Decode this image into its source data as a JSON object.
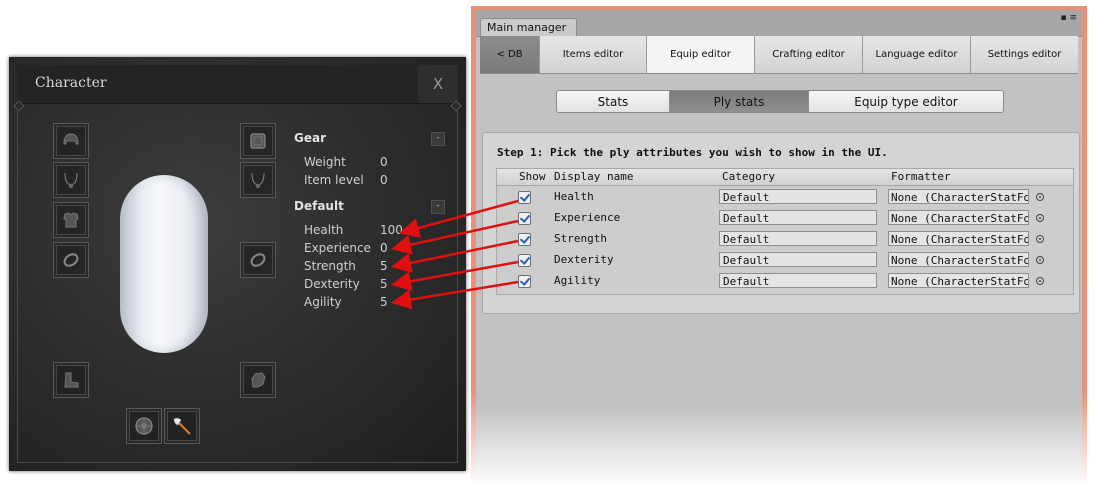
{
  "character": {
    "title": "Character",
    "close_label": "X",
    "equip_slots_left": [
      {
        "icon": "helmet-icon"
      },
      {
        "icon": "necklace-icon"
      },
      {
        "icon": "armor-icon"
      },
      {
        "icon": "ring-icon"
      }
    ],
    "equip_slots_right": [
      {
        "icon": "shield-frame-icon"
      },
      {
        "icon": "amulet-icon"
      },
      {
        "icon": "ring-icon"
      }
    ],
    "equip_slots_bottom": [
      {
        "icon": "boots-icon"
      },
      {
        "icon": "gauntlet-icon"
      },
      {
        "icon": "round-shield-icon"
      },
      {
        "icon": "axe-icon"
      }
    ],
    "gear": {
      "title": "Gear",
      "collapse_label": "-",
      "stats": [
        {
          "label": "Weight",
          "value": "0"
        },
        {
          "label": "Item level",
          "value": "0"
        }
      ]
    },
    "default": {
      "title": "Default",
      "collapse_label": "-",
      "stats": [
        {
          "label": "Health",
          "value": "100"
        },
        {
          "label": "Experience",
          "value": "0"
        },
        {
          "label": "Strength",
          "value": "5"
        },
        {
          "label": "Dexterity",
          "value": "5"
        },
        {
          "label": "Agility",
          "value": "5"
        }
      ]
    }
  },
  "manager": {
    "window_tab": "Main manager",
    "window_icons": "▪ ≡",
    "top_nav": [
      {
        "label": "< DB"
      },
      {
        "label": "Items editor"
      },
      {
        "label": "Equip editor"
      },
      {
        "label": "Crafting editor"
      },
      {
        "label": "Language editor"
      },
      {
        "label": "Settings editor"
      }
    ],
    "sub_nav": [
      {
        "label": "Stats"
      },
      {
        "label": "Ply stats"
      },
      {
        "label": "Equip type editor"
      }
    ],
    "step_label": "Step 1: Pick the ply attributes you wish to show in the UI.",
    "columns": {
      "show": "Show",
      "display_name": "Display name",
      "category": "Category",
      "formatter": "Formatter"
    },
    "rows": [
      {
        "checked": true,
        "display_name": "Health",
        "category": "Default",
        "formatter": "None (CharacterStatFor"
      },
      {
        "checked": true,
        "display_name": "Experience",
        "category": "Default",
        "formatter": "None (CharacterStatFor"
      },
      {
        "checked": true,
        "display_name": "Strength",
        "category": "Default",
        "formatter": "None (CharacterStatFor"
      },
      {
        "checked": true,
        "display_name": "Dexterity",
        "category": "Default",
        "formatter": "None (CharacterStatFor"
      },
      {
        "checked": true,
        "display_name": "Agility",
        "category": "Default",
        "formatter": "None (CharacterStatFor"
      }
    ]
  },
  "colors": {
    "arrow": "#e01010",
    "frame_accent": "#e8917a",
    "checkbox_check": "#2a5fb5"
  }
}
